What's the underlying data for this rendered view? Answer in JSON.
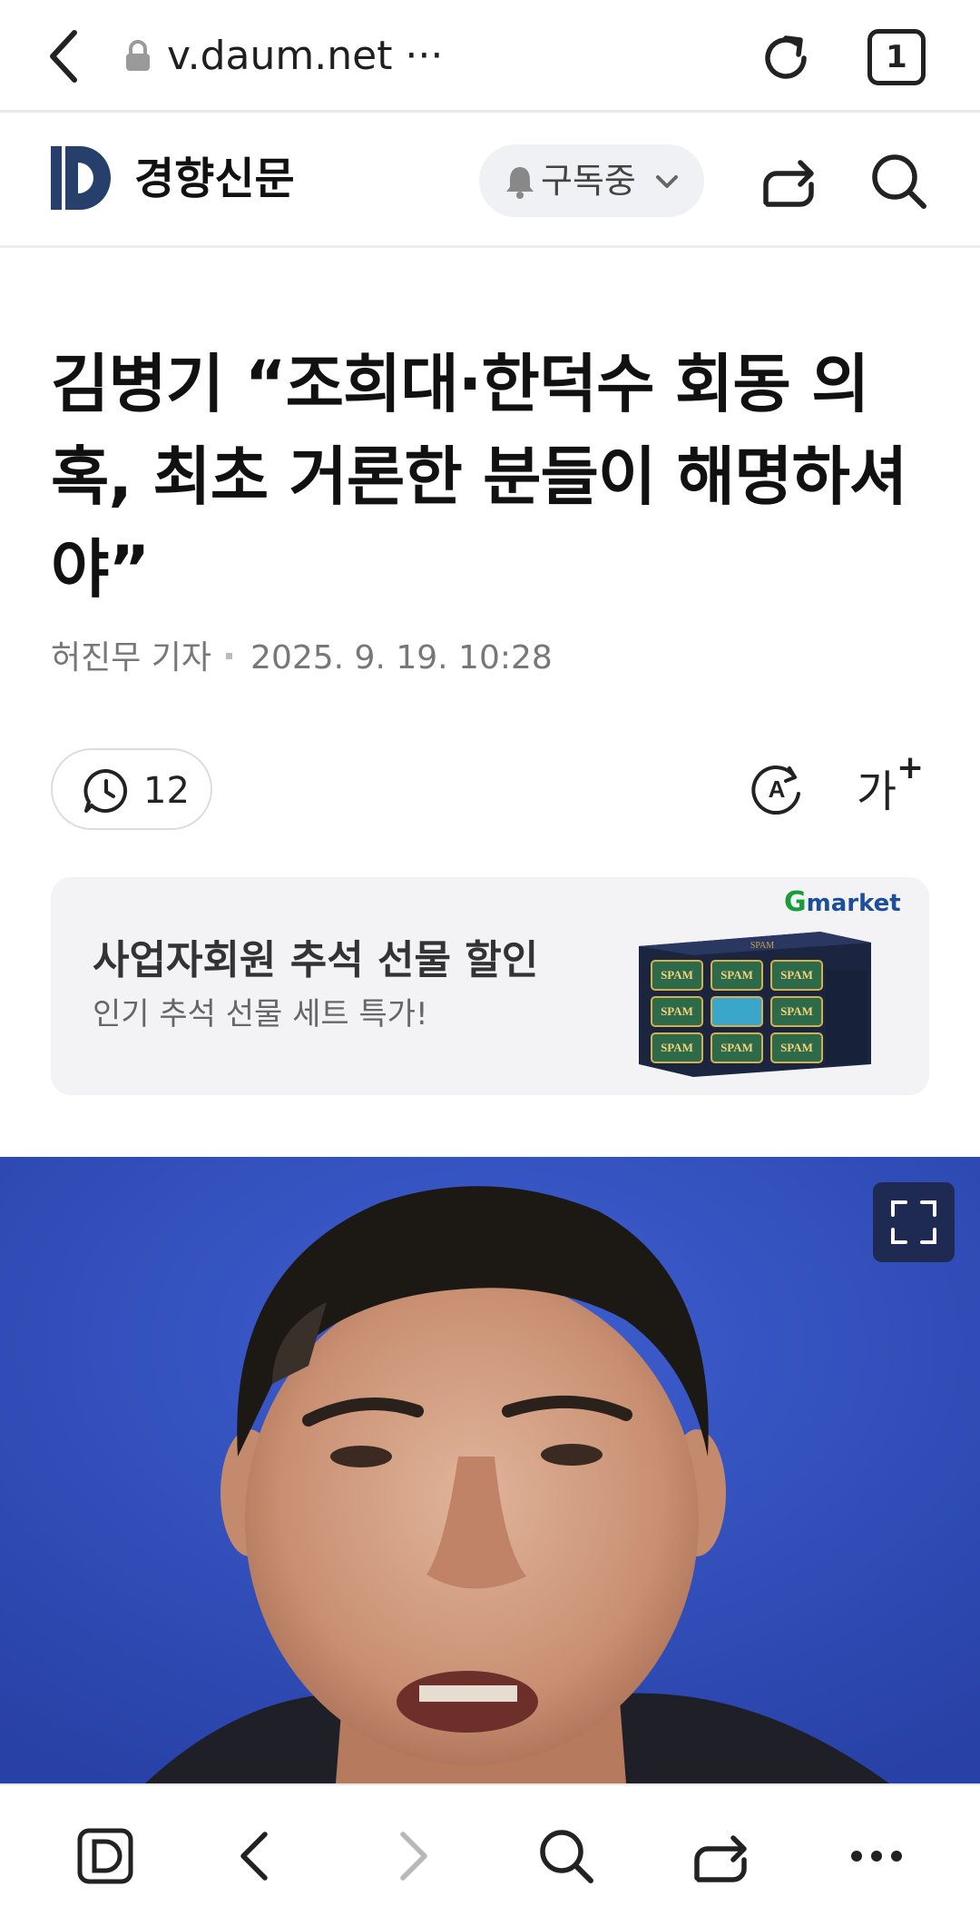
{
  "browser": {
    "url": "v.daum.net ···",
    "tab_count": "1"
  },
  "site": {
    "publisher": "경향신문",
    "subscribe_label": "구독중"
  },
  "article": {
    "headline": "김병기 “조희대·한덕수 회동 의혹, 최초 거론한 분들이 해명하셔야”",
    "reporter": "허진무 기자",
    "datetime": "2025. 9. 19. 10:28",
    "comment_count": "12",
    "font_size_label": "가",
    "font_size_plus": "+"
  },
  "ad": {
    "brand_g": "G",
    "brand_rest": "market",
    "title": "사업자회원 추석 선물 할인",
    "subtitle": "인기 추석 선물 세트 특가!",
    "product_label": "SPAM"
  },
  "icons": {
    "back": "chevron-left-icon",
    "lock": "lock-icon",
    "reload": "reload-icon",
    "share": "share-icon",
    "search": "search-icon",
    "expand": "expand-icon",
    "more": "more-icon"
  }
}
